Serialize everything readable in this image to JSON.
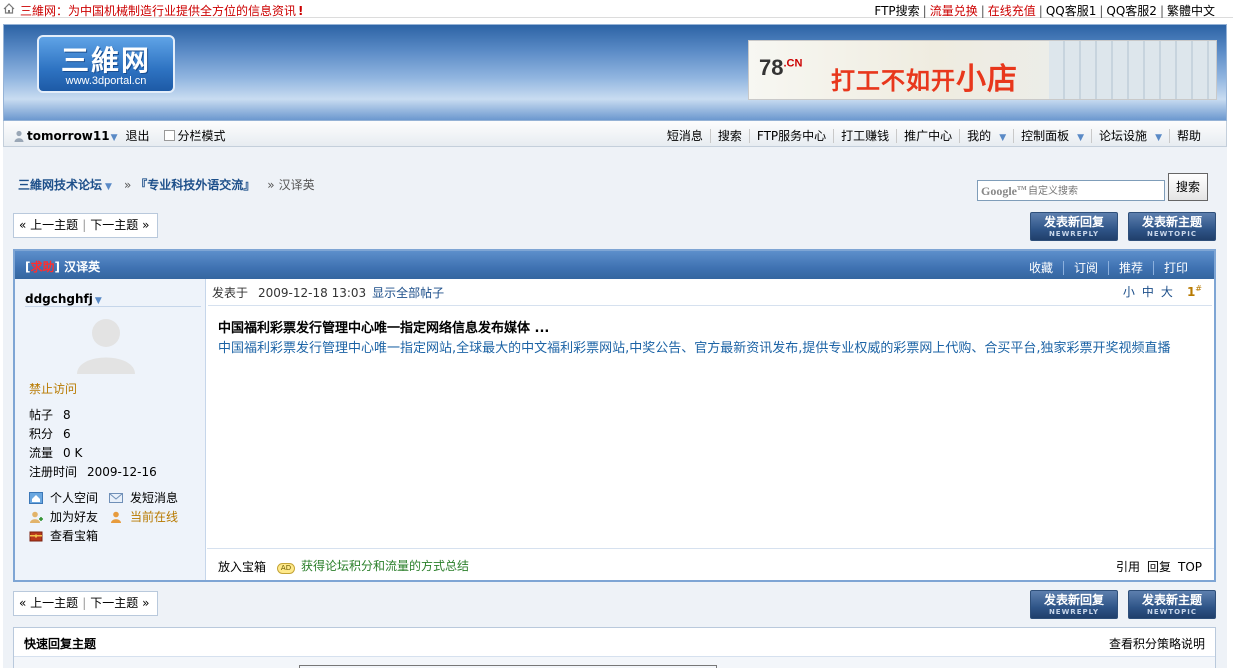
{
  "topbar": {
    "tagline": "三維网：为中国机械制造行业提供全方位的信息资讯",
    "bang": "!",
    "links": [
      {
        "label": "FTP搜索",
        "color": "#000000"
      },
      {
        "label": "流量兑换",
        "color": "#cc0000"
      },
      {
        "label": "在线充值",
        "color": "#cc0000"
      },
      {
        "label": "QQ客服1",
        "color": "#000000"
      },
      {
        "label": "QQ客服2",
        "color": "#000000"
      },
      {
        "label": "繁體中文",
        "color": "#000000"
      }
    ]
  },
  "header": {
    "logo_cn": "三維网",
    "logo_url": "www.3dportal.cn",
    "banner_brand": "78",
    "banner_brand_sup": ".CN",
    "banner_slogan": "打工不如开",
    "banner_slogan_big": "小店"
  },
  "navbar": {
    "username": "tomorrow11",
    "logout": "退出",
    "split_mode": "分栏模式",
    "items": [
      {
        "label": "短消息",
        "dropdown": false
      },
      {
        "label": "搜索",
        "dropdown": false
      },
      {
        "label": "FTP服务中心",
        "dropdown": false
      },
      {
        "label": "打工赚钱",
        "dropdown": false
      },
      {
        "label": "推广中心",
        "dropdown": false
      },
      {
        "label": "我的",
        "dropdown": true
      },
      {
        "label": "控制面板",
        "dropdown": true
      },
      {
        "label": "论坛设施",
        "dropdown": true
      },
      {
        "label": "帮助",
        "dropdown": false
      }
    ]
  },
  "breadcrumb": {
    "forum": "三維网技术论坛",
    "board": "『专业科技外语交流』",
    "thread": "汉译英",
    "sep": "»"
  },
  "search": {
    "logo": "Google",
    "placeholder": "自定义搜索",
    "button": "搜索"
  },
  "pager": {
    "prev": "上一主题",
    "next": "下一主题",
    "left_arrows": "«",
    "right_arrows": "»"
  },
  "buttons": {
    "reply_cn": "发表新回复",
    "reply_en": "NEWREPLY",
    "topic_cn": "发表新主题",
    "topic_en": "NEWTOPIC"
  },
  "post": {
    "tag_open": "[",
    "tag": "求助",
    "tag_close": "]",
    "title": "汉译英",
    "actions": [
      "收藏",
      "订阅",
      "推荐",
      "打印"
    ],
    "posted_label": "发表于",
    "date": "2009-12-18 13:03",
    "show_all": "显示全部帖子",
    "font_small": "小",
    "font_mid": "中",
    "font_big": "大",
    "floor": "1",
    "floor_sup": "#",
    "content_title": "中国福利彩票发行管理中心唯一指定网络信息发布媒体  ...",
    "content_body": "中国福利彩票发行管理中心唯一指定网站,全球最大的中文福利彩票网站,中奖公告、官方最新资讯发布,提供专业权威的彩票网上代购、合买平台,独家彩票开奖视频直播",
    "footer_box": "放入宝箱",
    "footer_ad": "获得论坛积分和流量的方式总结",
    "footer_ad_icon": "AD",
    "footer_actions": [
      "引用",
      "回复",
      "TOP"
    ]
  },
  "author": {
    "name": "ddgchghfj",
    "status": "禁止访问",
    "stats": [
      {
        "label": "帖子",
        "value": "8"
      },
      {
        "label": "积分",
        "value": "6"
      },
      {
        "label": "流量",
        "value": "0 K"
      },
      {
        "label": "注册时间",
        "value": "2009-12-16"
      }
    ],
    "actions": {
      "space": "个人空间",
      "message": "发短消息",
      "friend": "加为好友",
      "online": "当前在线",
      "treasure": "查看宝箱"
    }
  },
  "quick_reply": {
    "title": "快速回复主题",
    "policy": "查看积分策略说明"
  },
  "colors": {
    "accent_blue": "#3f72b2",
    "link_blue": "#1d4f8a",
    "alert_red": "#cc0000",
    "online_orange": "#b87a00"
  }
}
